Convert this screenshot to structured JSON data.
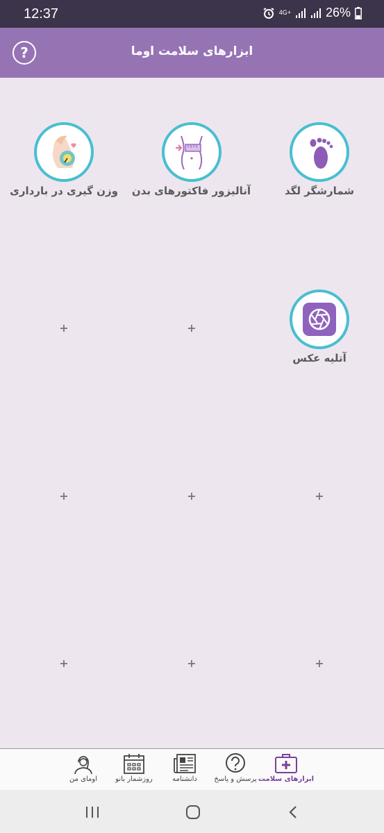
{
  "status_bar": {
    "time": "12:37",
    "network": "4G+",
    "battery": "26%"
  },
  "header": {
    "title": "ابزارهای سلامت اوما"
  },
  "tools": [
    {
      "label": "شمارشگر لگد",
      "icon": "footprint-icon"
    },
    {
      "label": "آنالیزور فاکتورهای بدن",
      "icon": "body-measure-icon"
    },
    {
      "label": "وزن گیری در بارداری",
      "icon": "pregnancy-weight-icon"
    },
    {
      "label": "آتلیه عکس",
      "icon": "camera-aperture-icon"
    }
  ],
  "empty_slots": {
    "symbol": "+"
  },
  "bottom_nav": [
    {
      "label": "ابزارهای سلامت",
      "icon": "medical-kit-icon",
      "active": true
    },
    {
      "label": "پرسش و پاسخ",
      "icon": "question-icon"
    },
    {
      "label": "دانشنامه",
      "icon": "newspaper-icon"
    },
    {
      "label": "روزشمار بانو",
      "icon": "calendar-icon"
    },
    {
      "label": "اومای من",
      "icon": "profile-icon"
    }
  ],
  "colors": {
    "header": "#9674B4",
    "accent_ring": "#48BFD0",
    "active_nav": "#7B3F99",
    "background": "#EEE6EF"
  }
}
